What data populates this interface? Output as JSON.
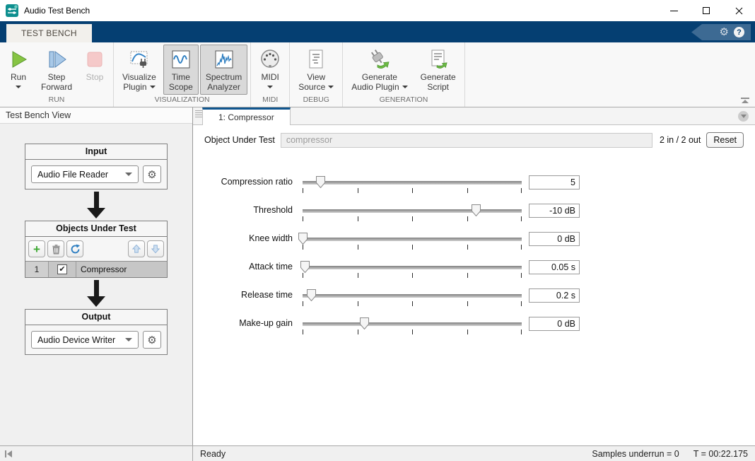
{
  "window": {
    "title": "Audio Test Bench"
  },
  "ribbon": {
    "tab_label": "TEST BENCH"
  },
  "icons": {
    "gear": "⚙",
    "help": "?",
    "check": "✔",
    "add": "+"
  },
  "toolbar": {
    "groups": [
      {
        "label": "RUN",
        "buttons": [
          {
            "line1": "Run",
            "line2": ""
          },
          {
            "line1": "Step",
            "line2": "Forward"
          },
          {
            "line1": "Stop",
            "line2": ""
          }
        ]
      },
      {
        "label": "VISUALIZATION",
        "buttons": [
          {
            "line1": "Visualize",
            "line2": "Plugin"
          },
          {
            "line1": "Time",
            "line2": "Scope"
          },
          {
            "line1": "Spectrum",
            "line2": "Analyzer"
          }
        ]
      },
      {
        "label": "MIDI",
        "buttons": [
          {
            "line1": "MIDI",
            "line2": ""
          }
        ]
      },
      {
        "label": "DEBUG",
        "buttons": [
          {
            "line1": "View",
            "line2": "Source"
          }
        ]
      },
      {
        "label": "GENERATION",
        "buttons": [
          {
            "line1": "Generate",
            "line2": "Audio Plugin"
          },
          {
            "line1": "Generate",
            "line2": "Script"
          }
        ]
      }
    ]
  },
  "left_panel": {
    "title": "Test Bench View",
    "input": {
      "title": "Input",
      "selected": "Audio File Reader"
    },
    "objects": {
      "title": "Objects Under Test",
      "row": {
        "index": "1",
        "name": "Compressor",
        "checked": true
      }
    },
    "output": {
      "title": "Output",
      "selected": "Audio Device Writer"
    }
  },
  "main": {
    "tab_label": "1: Compressor",
    "object_under_test": {
      "label": "Object Under Test",
      "value": "compressor"
    },
    "channels": "2 in / 2 out",
    "reset_label": "Reset",
    "sliders": [
      {
        "label": "Compression ratio",
        "value": "5",
        "thumb_pct": 8
      },
      {
        "label": "Threshold",
        "value": "-10 dB",
        "thumb_pct": 79
      },
      {
        "label": "Knee width",
        "value": "0 dB",
        "thumb_pct": 0
      },
      {
        "label": "Attack time",
        "value": "0.05 s",
        "thumb_pct": 1
      },
      {
        "label": "Release time",
        "value": "0.2 s",
        "thumb_pct": 4
      },
      {
        "label": "Make-up gain",
        "value": "0 dB",
        "thumb_pct": 28
      }
    ]
  },
  "status_bar": {
    "ready": "Ready",
    "samples": "Samples underrun = 0",
    "time": "T = 00:22.175"
  },
  "colors": {
    "ribbon_blue": "#053f72",
    "tab_accent": "#10568f",
    "run_green": "#86c443",
    "step_blue": "#a9c9e8",
    "stop_pink": "#f5c9c9",
    "selected_button_gray": "#d9d9d9",
    "selected_row_gray": "#c6c6c6",
    "app_icon_teal": "#0e8f8f"
  }
}
